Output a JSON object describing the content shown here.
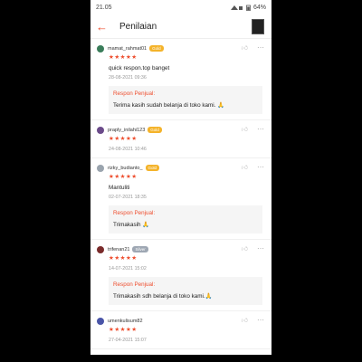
{
  "status": {
    "time": "21.05",
    "battery": "64%"
  },
  "header": {
    "title": "Penilaian"
  },
  "reviews": [
    {
      "user": "mamat_rahmat01",
      "badge": "Gold",
      "stars": "★★★★★",
      "comment": "quick respon.top banget",
      "date": "28-08-2021 09:36",
      "seller_label": "Respon Penjual:",
      "seller_reply": "Terima kasih sudah belanja di toko kami. 🙏"
    },
    {
      "user": "praply_inilahi123",
      "badge": "Gold",
      "stars": "★★★★★",
      "date": "24-08-2021 10:46"
    },
    {
      "user": "rizky_budianto_",
      "badge": "Gold",
      "stars": "★★★★★",
      "comment": "Mantuliti",
      "date": "02-07-2021 18:35",
      "seller_label": "Respon Penjual:",
      "seller_reply": "Trimakasih 🙏"
    },
    {
      "user": "trifenan21",
      "badge": "Silver",
      "stars": "★★★★★",
      "date": "14-07-2021 15:02",
      "seller_label": "Respon Penjual:",
      "seller_reply": "Trimakasih sdh belanja di toko kami.🙏"
    },
    {
      "user": "umenkulisum82",
      "stars": "★★★★★",
      "date": "27-04-2021 15:07"
    }
  ],
  "colors": {
    "accent": "#ee4d2d",
    "gold": "#f4b32a",
    "silver": "#9ea7b3"
  },
  "icons": {
    "back": "arrow-left-icon",
    "like": "thumbs-up-icon",
    "more": "more-dots-icon"
  }
}
